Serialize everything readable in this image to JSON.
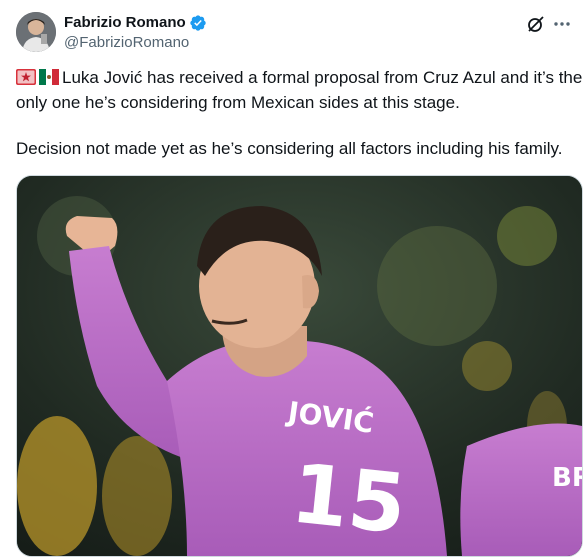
{
  "author": {
    "display_name": "Fabrizio Romano",
    "handle": "@FabrizioRomano",
    "verified": true
  },
  "icons": {
    "avatar": "avatar-photo",
    "verified": "verified-badge-icon",
    "grok": "grok-icon",
    "more": "more-options-icon",
    "flag_1": "flag-icon",
    "flag_2": "mexico-flag-icon"
  },
  "tweet": {
    "line1": "Luka Jović has received a formal proposal from Cruz Azul and it’s the only one he’s considering from Mexican sides at this stage.",
    "line2": "Decision not made yet as he’s considering all factors including his family."
  },
  "media": {
    "shirt_name": "JOVIĆ",
    "shirt_number": "15",
    "second_player_text": "BR"
  },
  "colors": {
    "verified_blue": "#1d9bf0",
    "handle_gray": "#536471",
    "kit_pink": "#c06ac8"
  }
}
